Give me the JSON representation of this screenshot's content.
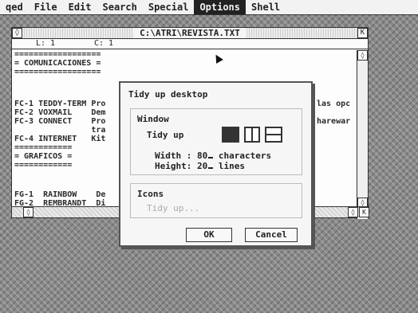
{
  "menubar": {
    "items": [
      "qed",
      "File",
      "Edit",
      "Search",
      "Special",
      "Options",
      "Shell"
    ],
    "active": "Options"
  },
  "window": {
    "title": "C:\\ATRI\\REVISTA.TXT",
    "line_label": "L: 1",
    "col_label": "C: 1",
    "lines": [
      "==================",
      "= COMUNICACIONES =",
      "==================",
      "",
      "FC-1 TEDDY-TERM Pro",
      "FC-2 VOXMAIL    Dem",
      "FC-3 CONNECT    Pro",
      "                tra",
      "FC-4 INTERNET   Kit",
      "============",
      "= GRAFICOS =",
      "============",
      "",
      "FG-1  RAINBOW    De",
      "FG-2  REMBRANDT  Di"
    ],
    "right_fragments": [
      "las opc",
      "harewar"
    ]
  },
  "dialog": {
    "title": "Tidy up desktop",
    "window_group_label": "Window",
    "tidy_label": "Tidy up",
    "width_label": "Width :",
    "width_value": "80",
    "width_unit": "characters",
    "height_label": "Height:",
    "height_value": "20",
    "height_unit": "lines",
    "icons_group_label": "Icons",
    "icons_tidy_label": "Tidy up...",
    "ok_label": "OK",
    "cancel_label": "Cancel"
  }
}
